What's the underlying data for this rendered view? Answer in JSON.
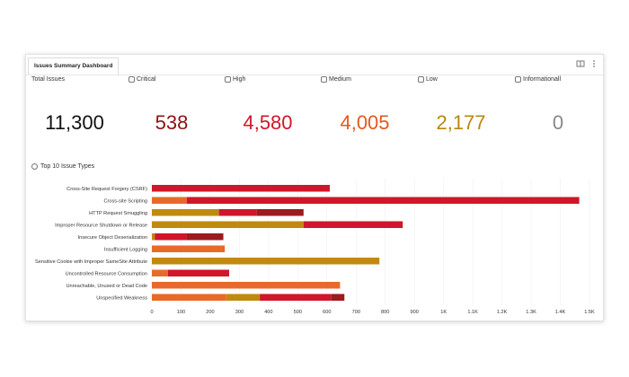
{
  "dashboard": {
    "tab_title": "Issues Summary Dashboard",
    "toolbar": {
      "layout_icon": "grid-icon",
      "menu_icon": "more-vertical-icon"
    }
  },
  "kpis": [
    {
      "label": "Total Issues",
      "value": "11,300",
      "color": "#111111"
    },
    {
      "label": "Critical",
      "value": "538",
      "color": "#8b1414"
    },
    {
      "label": "High",
      "value": "4,580",
      "color": "#d0162a"
    },
    {
      "label": "Medium",
      "value": "4,005",
      "color": "#e15a1e"
    },
    {
      "label": "Low",
      "value": "2,177",
      "color": "#b8860b"
    },
    {
      "label": "Informationall",
      "value": "0",
      "color": "#888888"
    }
  ],
  "section": {
    "title": "Top 10 Issue Types"
  },
  "colors": {
    "critical": "#9b1b1f",
    "high": "#d0162a",
    "medium": "#e86a2b",
    "low": "#c08a10"
  },
  "chart_data": {
    "type": "bar",
    "orientation": "horizontal",
    "stacked": true,
    "categories": [
      "Cross-Site Request Forgery (CSRF)",
      "Cross-site Scripting",
      "HTTP Request Smuggling",
      "Improper Resource Shutdown or Release",
      "Insecure Object Deserialization",
      "Insufficient Logging",
      "Sensitive Cookie with Improper SameSite Attribute",
      "Uncontrolled Resource Consumption",
      "Unreachable, Unused or Dead Code",
      "Unspecified Weakness"
    ],
    "series": [
      {
        "key": "medium",
        "values": [
          0,
          120,
          0,
          0,
          0,
          250,
          0,
          55,
          645,
          255
        ]
      },
      {
        "key": "low",
        "values": [
          0,
          0,
          230,
          520,
          10,
          0,
          780,
          0,
          0,
          115
        ]
      },
      {
        "key": "high",
        "values": [
          610,
          1345,
          130,
          340,
          110,
          0,
          0,
          210,
          0,
          245
        ]
      },
      {
        "key": "critical",
        "values": [
          0,
          0,
          160,
          0,
          125,
          0,
          0,
          0,
          0,
          45
        ]
      }
    ],
    "x_ticks": [
      "0",
      "100",
      "200",
      "300",
      "400",
      "500",
      "600",
      "700",
      "800",
      "900",
      "1K",
      "1.1K",
      "1.2K",
      "1.3K",
      "1.4K",
      "1.5K"
    ],
    "xlim": [
      0,
      1500
    ],
    "grid": true
  }
}
